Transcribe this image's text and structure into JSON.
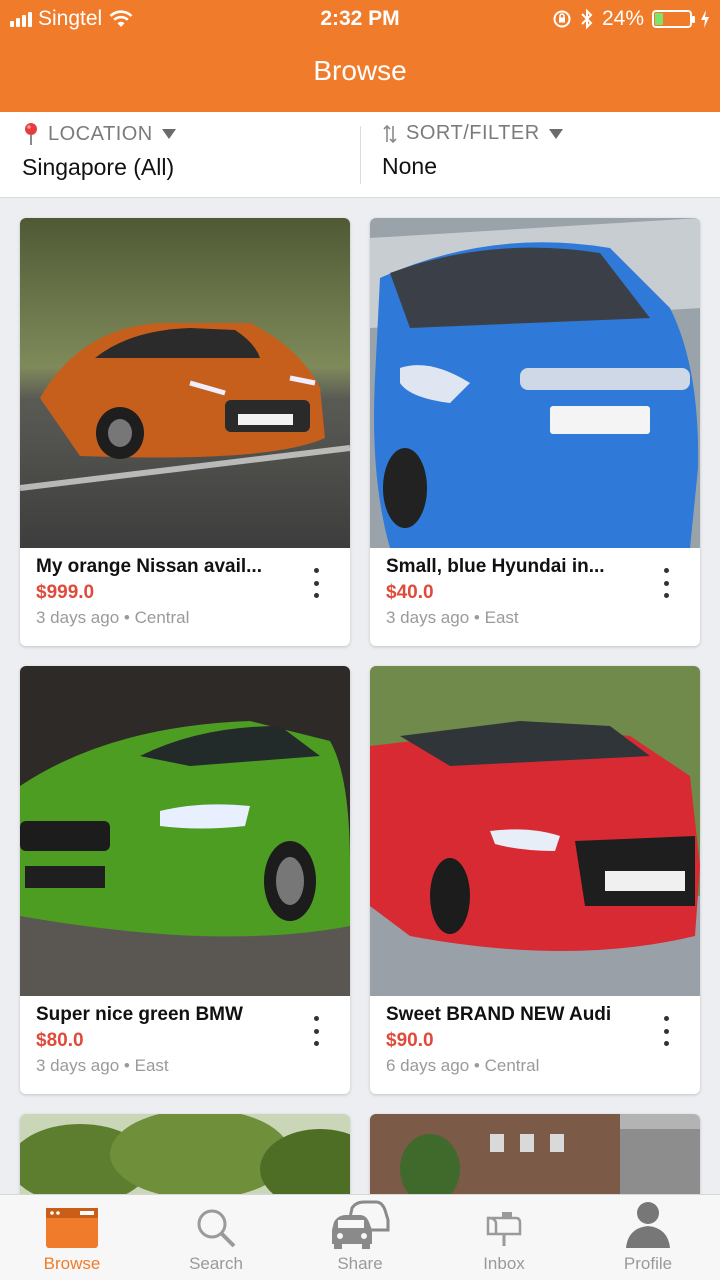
{
  "status_bar": {
    "carrier": "Singtel",
    "time": "2:32 PM",
    "battery": "24%",
    "battery_level": 0.24
  },
  "header": {
    "title": "Browse"
  },
  "filters": {
    "location": {
      "label": "LOCATION",
      "value": "Singapore (All)",
      "icon": "pin-icon"
    },
    "sort": {
      "label": "SORT/FILTER",
      "value": "None",
      "icon": "sort-icon"
    }
  },
  "listings": [
    {
      "title": "My orange Nissan avail...",
      "price": "$999.0",
      "age": "3 days ago",
      "region": "Central",
      "color": "#c65f1c"
    },
    {
      "title": "Small, blue Hyundai in...",
      "price": "$40.0",
      "age": "3 days ago",
      "region": "East",
      "color": "#2f79d8"
    },
    {
      "title": "Super nice green BMW",
      "price": "$80.0",
      "age": "3 days ago",
      "region": "East",
      "color": "#4c9d22"
    },
    {
      "title": "Sweet BRAND NEW Audi",
      "price": "$90.0",
      "age": "6 days ago",
      "region": "Central",
      "color": "#d82a33"
    }
  ],
  "meta_separator": "•",
  "tabs": [
    {
      "label": "Browse",
      "icon": "browse-icon",
      "active": true
    },
    {
      "label": "Search",
      "icon": "search-icon",
      "active": false
    },
    {
      "label": "Share",
      "icon": "share-cars-icon",
      "active": false
    },
    {
      "label": "Inbox",
      "icon": "inbox-mailbox-icon",
      "active": false
    },
    {
      "label": "Profile",
      "icon": "profile-icon",
      "active": false
    }
  ],
  "colors": {
    "accent": "#f07c2b",
    "price": "#e04a3a"
  }
}
